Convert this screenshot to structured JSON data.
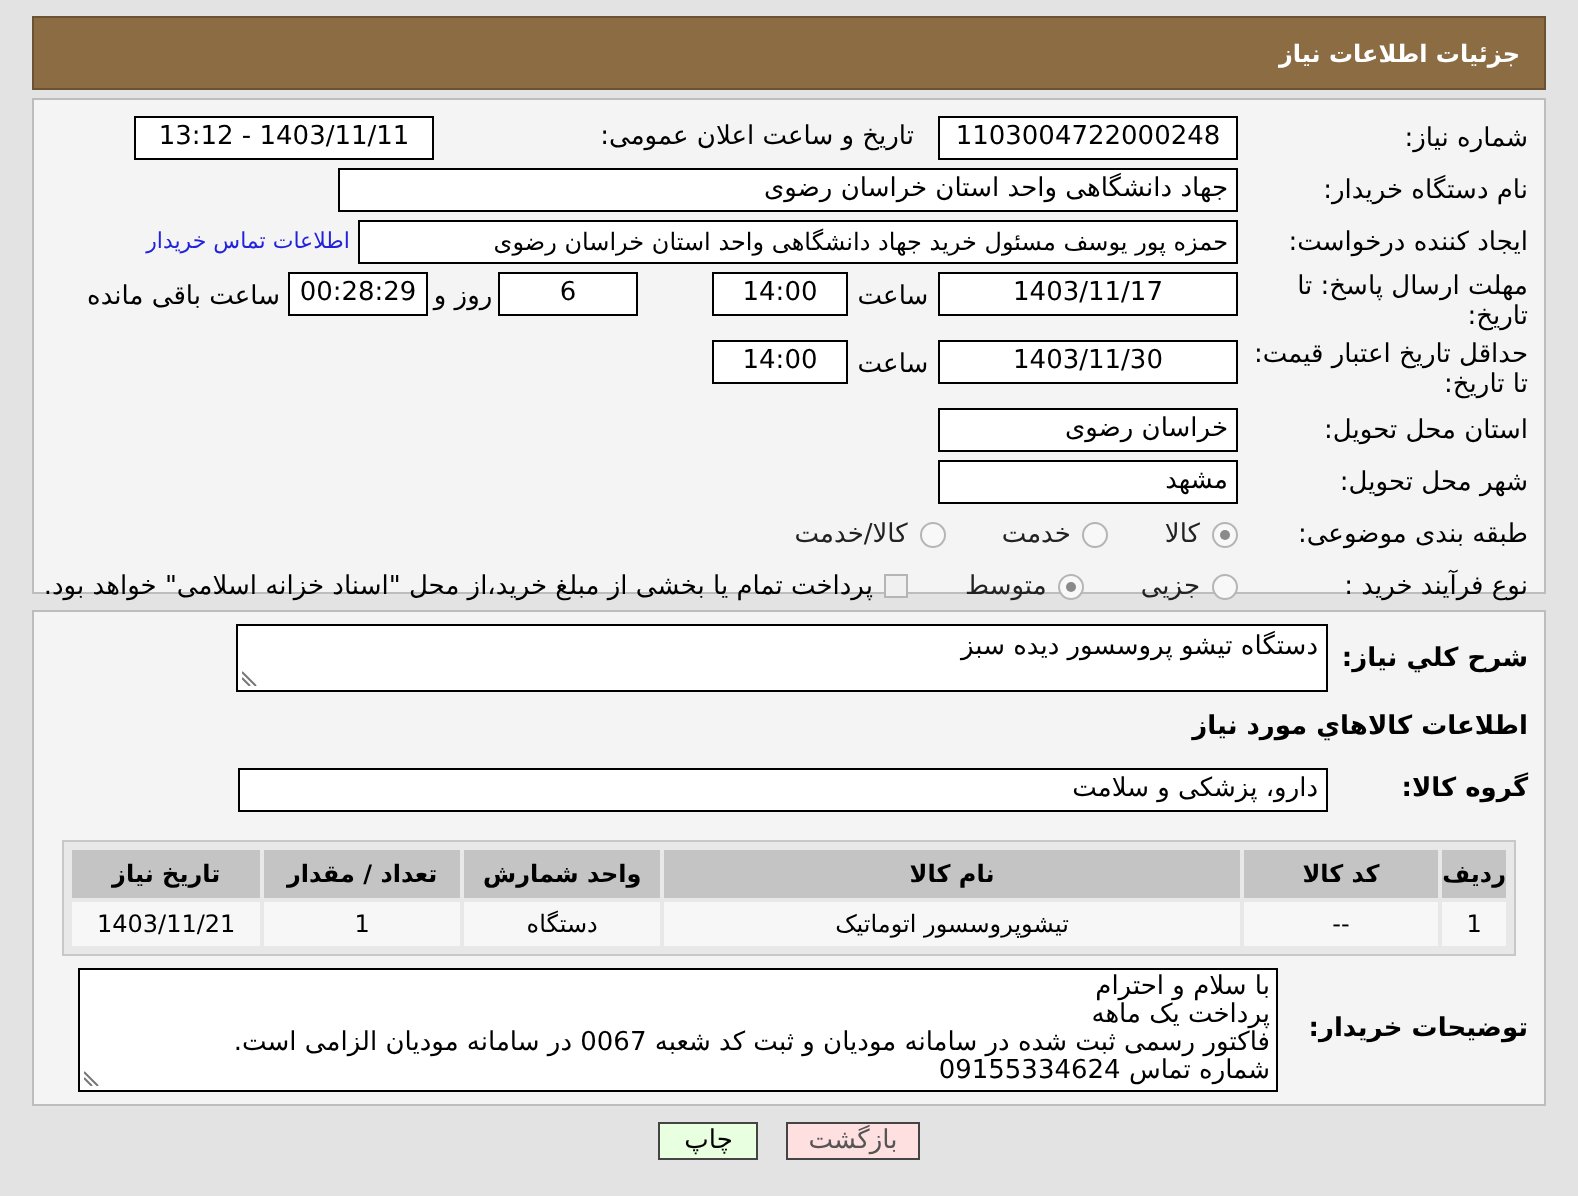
{
  "header": {
    "title": "جزئیات اطلاعات نیاز"
  },
  "need_number": {
    "label": "شماره نیاز:",
    "value": "1103004722000248"
  },
  "announce": {
    "label": "تاریخ و ساعت اعلان عمومی:",
    "value": "1403/11/11 - 13:12"
  },
  "buyer_org": {
    "label": "نام دستگاه خریدار:",
    "value": "جهاد دانشگاهی واحد استان خراسان رضوی"
  },
  "requester": {
    "label": "ایجاد کننده درخواست:",
    "value": "حمزه  پور یوسف مسئول خرید جهاد دانشگاهی واحد استان خراسان رضوی",
    "link": "اطلاعات تماس خریدار"
  },
  "deadline": {
    "label": "مهلت ارسال پاسخ: تا تاریخ:",
    "date": "1403/11/17",
    "time_label": "ساعت",
    "time": "14:00",
    "days": "6",
    "days_label": "روز و",
    "remaining": "00:28:29",
    "remaining_label": "ساعت باقی مانده"
  },
  "validity": {
    "label": "حداقل تاریخ اعتبار قیمت: تا تاریخ:",
    "date": "1403/11/30",
    "time_label": "ساعت",
    "time": "14:00"
  },
  "province": {
    "label": "استان محل تحویل:",
    "value": "خراسان رضوی"
  },
  "city": {
    "label": "شهر محل تحویل:",
    "value": "مشهد"
  },
  "category": {
    "label": "طبقه بندی موضوعی:",
    "options": [
      {
        "label": "کالا",
        "selected": true
      },
      {
        "label": "خدمت",
        "selected": false
      },
      {
        "label": "کالا/خدمت",
        "selected": false
      }
    ]
  },
  "process": {
    "label": "نوع فرآیند خرید :",
    "options": [
      {
        "label": "جزیی",
        "selected": false
      },
      {
        "label": "متوسط",
        "selected": true
      }
    ],
    "note": {
      "label": "پرداخت تمام یا بخشی از مبلغ خرید،از محل \"اسناد خزانه اسلامی\" خواهد بود.",
      "checked": false
    }
  },
  "summary": {
    "label": "شرح کلي نياز:",
    "value": "دستگاه تیشو پروسسور دیده سبز"
  },
  "goods_heading": "اطلاعات كالاهاي مورد نياز",
  "goods_group": {
    "label": "گروه کالا:",
    "value": "دارو، پزشکی و سلامت"
  },
  "table": {
    "columns": [
      "ردیف",
      "کد کالا",
      "نام کالا",
      "واحد شمارش",
      "تعداد / مقدار",
      "تاریخ نیاز"
    ],
    "rows": [
      [
        "1",
        "--",
        "تیشوپروسسور اتوماتیک",
        "دستگاه",
        "1",
        "1403/11/21"
      ]
    ]
  },
  "buyer_notes": {
    "label": "توضیحات خریدار:",
    "lines": [
      "با سلام و احترام",
      "پرداخت یک ماهه",
      "فاکتور رسمی ثبت شده در سامانه مودیان و ثبت کد شعبه 0067 در سامانه مودیان الزامی است.",
      "شماره تماس 09155334624"
    ]
  },
  "buttons": [
    {
      "label": "بازگشت",
      "kind": "back"
    },
    {
      "label": "چاپ",
      "kind": "print"
    }
  ]
}
